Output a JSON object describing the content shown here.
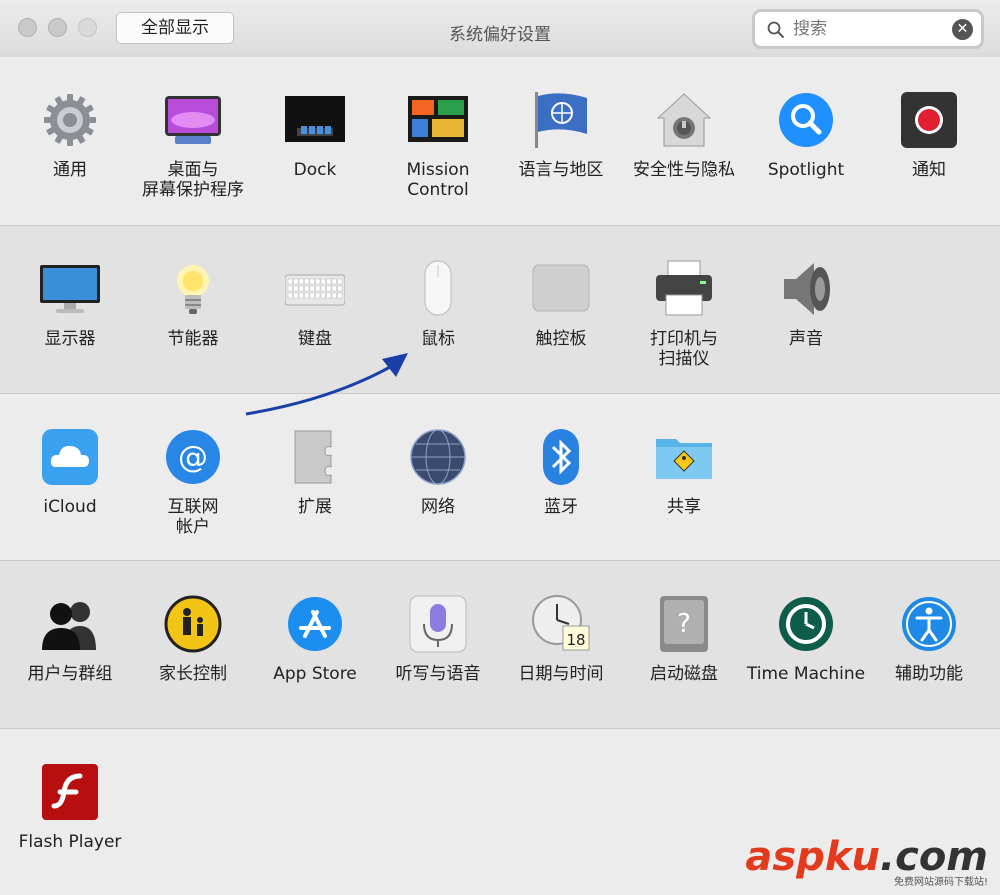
{
  "window": {
    "title": "系统偏好设置"
  },
  "toolbar": {
    "show_all_label": "全部显示"
  },
  "search": {
    "value": "",
    "placeholder": "搜索"
  },
  "rows": [
    {
      "panes": [
        {
          "label": "通用",
          "icon": "gear-icon"
        },
        {
          "label": "桌面与\n屏幕保护程序",
          "icon": "desktop-screensaver-icon"
        },
        {
          "label": "Dock",
          "icon": "dock-icon"
        },
        {
          "label": "Mission\nControl",
          "icon": "mission-control-icon"
        },
        {
          "label": "语言与地区",
          "icon": "un-flag-icon"
        },
        {
          "label": "安全性与隐私",
          "icon": "lock-house-icon"
        },
        {
          "label": "Spotlight",
          "icon": "magnifier-icon"
        },
        {
          "label": "通知",
          "icon": "notifications-icon"
        }
      ]
    },
    {
      "panes": [
        {
          "label": "显示器",
          "icon": "monitor-icon"
        },
        {
          "label": "节能器",
          "icon": "lightbulb-icon"
        },
        {
          "label": "键盘",
          "icon": "keyboard-icon"
        },
        {
          "label": "鼠标",
          "icon": "mouse-icon"
        },
        {
          "label": "触控板",
          "icon": "trackpad-icon"
        },
        {
          "label": "打印机与\n扫描仪",
          "icon": "printer-icon"
        },
        {
          "label": "声音",
          "icon": "speaker-icon"
        }
      ]
    },
    {
      "panes": [
        {
          "label": "iCloud",
          "icon": "cloud-icon"
        },
        {
          "label": "互联网\n帐户",
          "icon": "at-sign-icon"
        },
        {
          "label": "扩展",
          "icon": "puzzle-icon"
        },
        {
          "label": "网络",
          "icon": "globe-icon"
        },
        {
          "label": "蓝牙",
          "icon": "bluetooth-icon"
        },
        {
          "label": "共享",
          "icon": "shared-folder-icon"
        }
      ]
    },
    {
      "panes": [
        {
          "label": "用户与群组",
          "icon": "users-icon"
        },
        {
          "label": "家长控制",
          "icon": "parental-icon"
        },
        {
          "label": "App Store",
          "icon": "app-store-icon"
        },
        {
          "label": "听写与语音",
          "icon": "microphone-icon"
        },
        {
          "label": "日期与时间",
          "icon": "clock-calendar-icon",
          "badge": "18"
        },
        {
          "label": "启动磁盘",
          "icon": "hard-disk-icon"
        },
        {
          "label": "Time Machine",
          "icon": "time-machine-icon"
        },
        {
          "label": "辅助功能",
          "icon": "accessibility-icon"
        }
      ]
    },
    {
      "panes": [
        {
          "label": "Flash Player",
          "icon": "flash-player-icon"
        }
      ]
    }
  ],
  "annotation": {
    "arrow_color": "#1a3fa8"
  },
  "watermark": {
    "text_a": "asp",
    "text_b": "ku",
    "text_c": ".com",
    "subtitle": "免费网站源码下载站!"
  }
}
